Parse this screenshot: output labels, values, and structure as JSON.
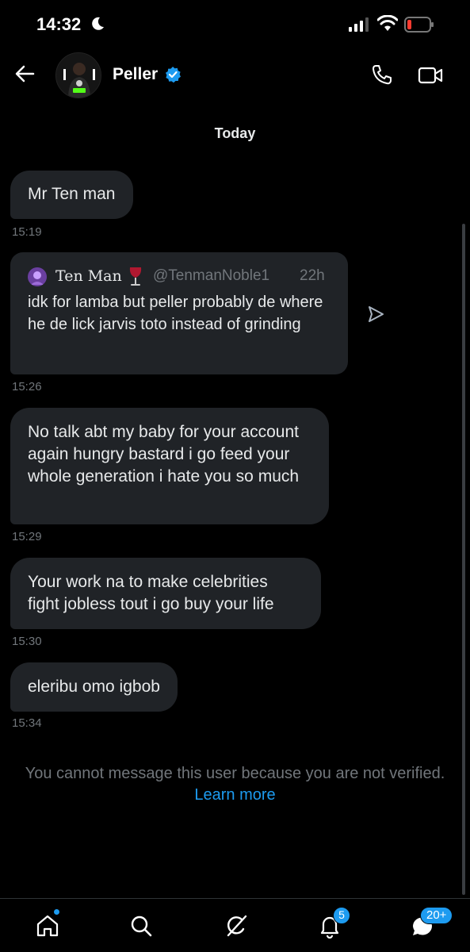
{
  "status_bar": {
    "time": "14:32"
  },
  "header": {
    "contact_name": "Peller"
  },
  "conversation": {
    "day_label": "Today",
    "messages": [
      {
        "text": "Mr Ten man",
        "time": "15:19"
      },
      {
        "quote": {
          "name": "Ten Man",
          "handle": "@TenmanNoble1",
          "age": "22h",
          "text": "idk for lamba but peller probably de where he de lick jarvis toto instead of grinding"
        },
        "time": "15:26"
      },
      {
        "text": "No talk abt my baby for your account again hungry bastard i go feed your whole generation i hate you so much",
        "time": "15:29"
      },
      {
        "text": "Your work na to make celebrities fight jobless tout i go buy your life",
        "time": "15:30"
      },
      {
        "text": "eleribu omo igbob",
        "time": "15:34"
      }
    ]
  },
  "notice": {
    "text": "You cannot message this user because you are not verified.",
    "link": "Learn more"
  },
  "tabbar": {
    "notifications_badge": "5",
    "messages_badge": "20+"
  },
  "colors": {
    "accent": "#1d9bf0",
    "bubble": "#202327",
    "muted": "#71767b"
  }
}
